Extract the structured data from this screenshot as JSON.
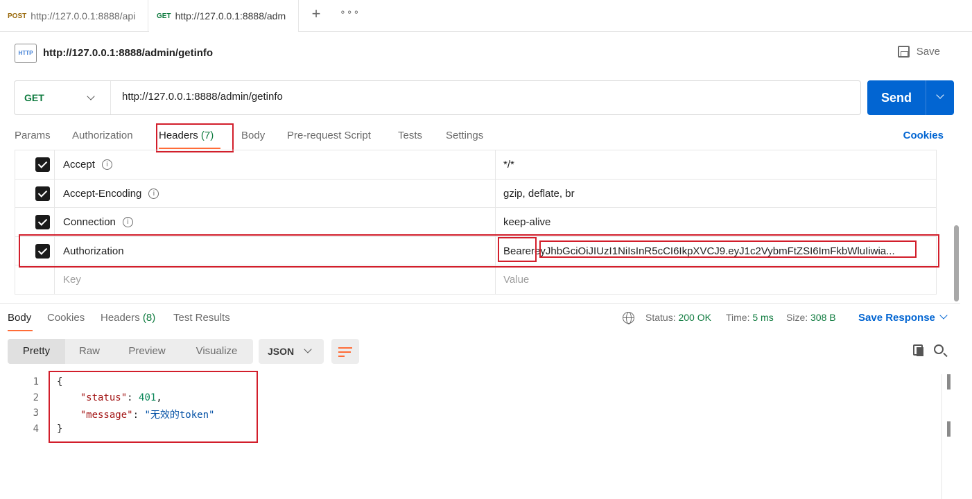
{
  "tabs": [
    {
      "method": "POST",
      "url": "http://127.0.0.1:8888/api"
    },
    {
      "method": "GET",
      "url": "http://127.0.0.1:8888/adm"
    }
  ],
  "tab_actions": {
    "new": "+",
    "more": "ooo"
  },
  "request": {
    "icon_text": "HTTP",
    "title": "http://127.0.0.1:8888/admin/getinfo",
    "save_label": "Save",
    "method": "GET",
    "url": "http://127.0.0.1:8888/admin/getinfo",
    "send_label": "Send"
  },
  "request_tabs": {
    "params": "Params",
    "authorization": "Authorization",
    "headers": "Headers",
    "headers_count": "(7)",
    "body": "Body",
    "prerequest": "Pre-request Script",
    "tests": "Tests",
    "settings": "Settings",
    "cookies": "Cookies"
  },
  "headers": [
    {
      "key": "Accept",
      "value": "*/*",
      "info": true,
      "checked": true
    },
    {
      "key": "Accept-Encoding",
      "value": "gzip, deflate, br",
      "info": true,
      "checked": true
    },
    {
      "key": "Connection",
      "value": "keep-alive",
      "info": true,
      "checked": true
    },
    {
      "key": "Authorization",
      "value_prefix": "Bearer",
      "value_token": "eyJhbGciOiJIUzI1NiIsInR5cCI6IkpXVCJ9.eyJ1c2VybmFtZSI6ImFkbWluIiwia...",
      "info": false,
      "checked": true
    }
  ],
  "headers_placeholder": {
    "key": "Key",
    "value": "Value"
  },
  "response_tabs": {
    "body": "Body",
    "cookies": "Cookies",
    "headers": "Headers",
    "headers_count": "(8)",
    "test_results": "Test Results"
  },
  "status_bar": {
    "status_label": "Status:",
    "status_value": "200 OK",
    "time_label": "Time:",
    "time_value": "5 ms",
    "size_label": "Size:",
    "size_value": "308 B",
    "save_response": "Save Response"
  },
  "format": {
    "pretty": "Pretty",
    "raw": "Raw",
    "preview": "Preview",
    "visualize": "Visualize",
    "language": "JSON"
  },
  "response_body": {
    "line_numbers": [
      "1",
      "2",
      "3",
      "4"
    ],
    "open_brace": "{",
    "close_brace": "}",
    "status_key": "\"status\"",
    "status_value": "401",
    "message_key": "\"message\"",
    "message_value": "\"无效的token\""
  },
  "colors": {
    "accent": "#ff6c37",
    "primary": "#0265d2",
    "success": "#0f7b3f",
    "highlight": "#d21e2b"
  }
}
